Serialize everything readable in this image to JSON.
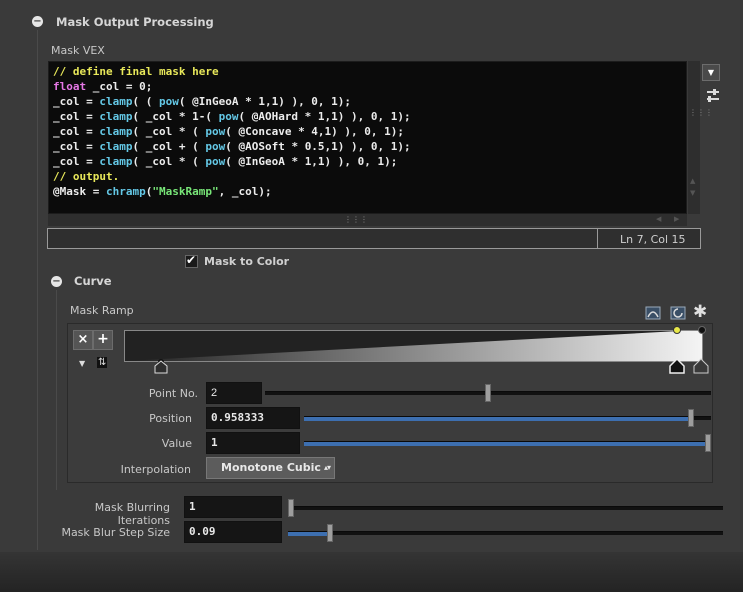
{
  "section": {
    "title": "Mask Output Processing"
  },
  "vex": {
    "label": "Mask VEX",
    "lines": [
      [
        {
          "t": "// define final mask here",
          "c": "c-comment"
        }
      ],
      [
        {
          "t": "float",
          "c": "c-kw"
        },
        {
          "t": " _col = 0;",
          "c": "c-plain"
        }
      ],
      [
        {
          "t": "_col = ",
          "c": "c-plain"
        },
        {
          "t": "clamp",
          "c": "c-fn"
        },
        {
          "t": "( ( ",
          "c": "c-plain"
        },
        {
          "t": "pow",
          "c": "c-fn"
        },
        {
          "t": "( @InGeoA * 1,1) ), 0, 1);",
          "c": "c-plain"
        }
      ],
      [
        {
          "t": "_col = ",
          "c": "c-plain"
        },
        {
          "t": "clamp",
          "c": "c-fn"
        },
        {
          "t": "( _col * 1-( ",
          "c": "c-plain"
        },
        {
          "t": "pow",
          "c": "c-fn"
        },
        {
          "t": "( @AOHard * 1,1) ), 0, 1);",
          "c": "c-plain"
        }
      ],
      [
        {
          "t": "_col = ",
          "c": "c-plain"
        },
        {
          "t": "clamp",
          "c": "c-fn"
        },
        {
          "t": "( _col * ( ",
          "c": "c-plain"
        },
        {
          "t": "pow",
          "c": "c-fn"
        },
        {
          "t": "( @Concave * 4,1) ), 0, 1);",
          "c": "c-plain"
        }
      ],
      [
        {
          "t": "_col = ",
          "c": "c-plain"
        },
        {
          "t": "clamp",
          "c": "c-fn"
        },
        {
          "t": "( _col + ( ",
          "c": "c-plain"
        },
        {
          "t": "pow",
          "c": "c-fn"
        },
        {
          "t": "( @AOSoft * 0.5,1) ), 0, 1);",
          "c": "c-plain"
        }
      ],
      [
        {
          "t": "_col = ",
          "c": "c-plain"
        },
        {
          "t": "clamp",
          "c": "c-fn"
        },
        {
          "t": "( _col * ( ",
          "c": "c-plain"
        },
        {
          "t": "pow",
          "c": "c-fn"
        },
        {
          "t": "( @InGeoA * 1,1) ), 0, 1);",
          "c": "c-plain"
        }
      ],
      [
        {
          "t": "// output.",
          "c": "c-comment"
        }
      ],
      [
        {
          "t": "@Mask = ",
          "c": "c-plain"
        },
        {
          "t": "chramp",
          "c": "c-fn"
        },
        {
          "t": "(",
          "c": "c-plain"
        },
        {
          "t": "\"MaskRamp\"",
          "c": "c-str"
        },
        {
          "t": ", _col);",
          "c": "c-plain"
        }
      ]
    ],
    "status": "Ln 7, Col 15"
  },
  "mask_to_color": {
    "label": "Mask to Color",
    "checked": true
  },
  "curve": {
    "title": "Curve",
    "ramp_label": "Mask Ramp",
    "point_no": {
      "label": "Point No.",
      "value": "2",
      "fraction": 0.5
    },
    "position": {
      "label": "Position",
      "value": "0.958333",
      "fraction": 0.958333
    },
    "value": {
      "label": "Value",
      "value": "1",
      "fraction": 1.0
    },
    "interpolation": {
      "label": "Interpolation",
      "value": "Monotone Cubic"
    }
  },
  "blur_iterations": {
    "label": "Mask Blurring Iterations",
    "value": "1",
    "fraction": 0.0
  },
  "blur_step": {
    "label": "Mask Blur Step Size",
    "value": "0.09",
    "fraction": 0.09
  },
  "icons": {
    "collapse": "minus-circle-icon",
    "check": "checkmark-icon",
    "gear": "gear-icon"
  },
  "glyphs": {
    "collapse": "−",
    "check": "✔",
    "close": "×",
    "add": "+",
    "dropdown_arrow": "▼",
    "spin": "▴▾",
    "gear": "✱",
    "grip": "⋮⋮⋮",
    "scroll_up": "▲",
    "scroll_down": "▼",
    "scroll_left": "◀",
    "scroll_right": "▶",
    "expand": "▼",
    "swap": "⇅"
  },
  "colors": {
    "accent": "#3d6fb0",
    "background": "#3a3a3a",
    "editor_bg": "#0b0b0b"
  }
}
